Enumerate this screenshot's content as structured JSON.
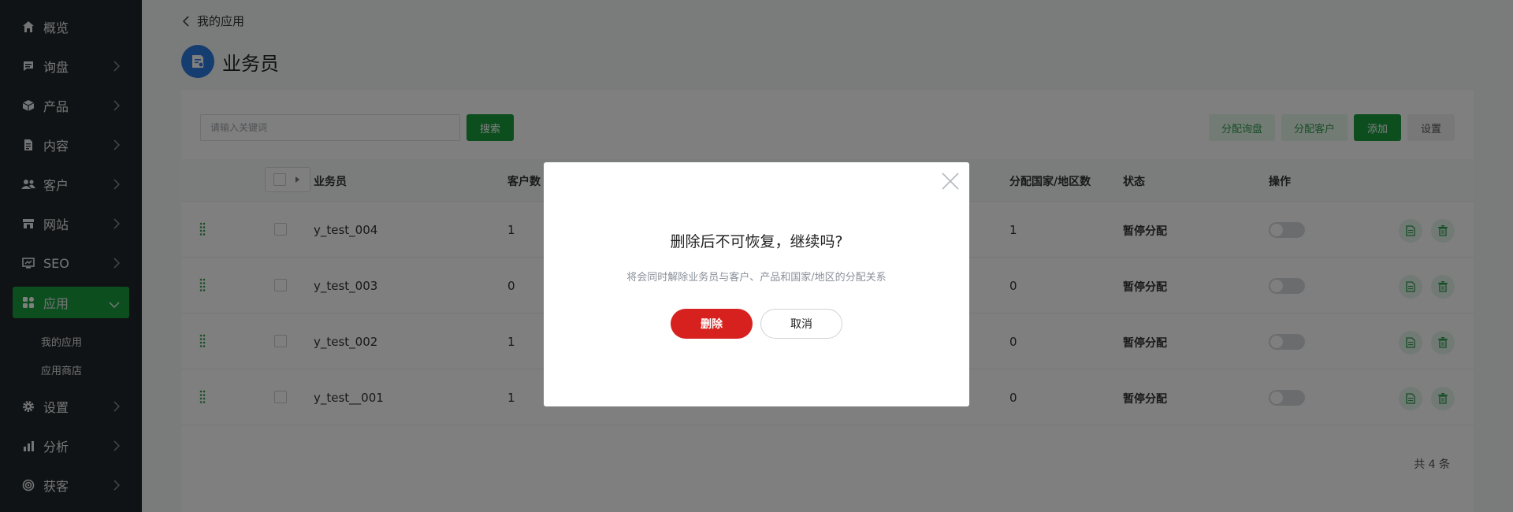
{
  "sidebar": {
    "items": [
      {
        "label": "概览",
        "icon": "home-icon"
      },
      {
        "label": "询盘",
        "icon": "message-icon"
      },
      {
        "label": "产品",
        "icon": "box-icon"
      },
      {
        "label": "内容",
        "icon": "document-icon"
      },
      {
        "label": "客户",
        "icon": "users-icon"
      },
      {
        "label": "网站",
        "icon": "store-icon"
      },
      {
        "label": "SEO",
        "icon": "monitor-chart-icon"
      },
      {
        "label": "应用",
        "icon": "apps-icon"
      },
      {
        "label": "设置",
        "icon": "gear-icon"
      },
      {
        "label": "分析",
        "icon": "bar-chart-icon"
      },
      {
        "label": "获客",
        "icon": "target-icon"
      }
    ],
    "sub_items": [
      {
        "label": "我的应用"
      },
      {
        "label": "应用商店"
      }
    ],
    "active_color": "#1a9c3e"
  },
  "header": {
    "back_label": "我的应用",
    "title": "业务员"
  },
  "toolbar": {
    "search_placeholder": "请输入关键词",
    "search_label": "搜索",
    "assign_inquiry_label": "分配询盘",
    "assign_customer_label": "分配客户",
    "add_label": "添加",
    "settings_label": "设置"
  },
  "table": {
    "columns": [
      "业务员",
      "客户数",
      "分配国家/地区数",
      "状态",
      "操作"
    ],
    "rows": [
      {
        "name": "y_test_004",
        "customers": "1",
        "countries": "1",
        "status": "暂停分配"
      },
      {
        "name": "y_test_003",
        "customers": "0",
        "countries": "0",
        "status": "暂停分配"
      },
      {
        "name": "y_test_002",
        "customers": "1",
        "countries": "0",
        "status": "暂停分配"
      },
      {
        "name": "y_test__001",
        "customers": "1",
        "countries": "0",
        "status": "暂停分配"
      }
    ],
    "total": "共 4 条"
  },
  "dialog": {
    "title": "删除后不可恢复，继续吗?",
    "subtitle": "将会同时解除业务员与客户、产品和国家/地区的分配关系",
    "delete_label": "删除",
    "cancel_label": "取消"
  },
  "colors": {
    "brand_green": "#1a9c3e",
    "danger_red": "#d7211e",
    "sidebar_bg": "#20272a"
  }
}
